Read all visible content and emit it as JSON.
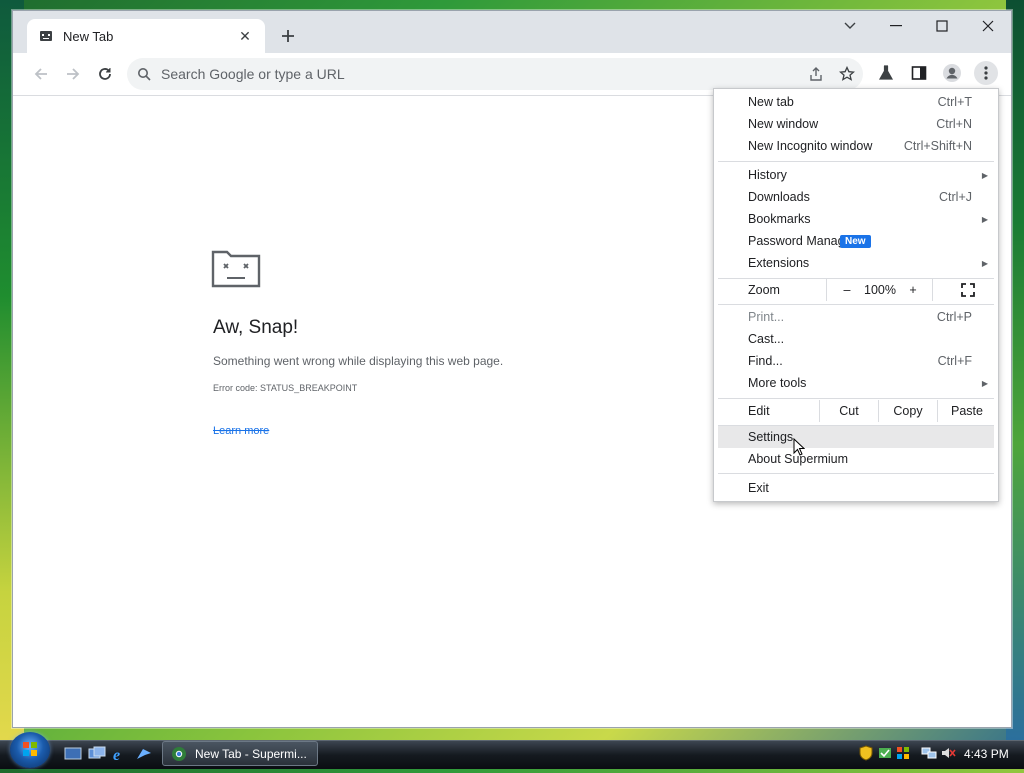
{
  "browser": {
    "tab_title": "New Tab",
    "omnibox_placeholder": "Search Google or type a URL"
  },
  "error_page": {
    "title": "Aw, Snap!",
    "message": "Something went wrong while displaying this web page.",
    "error_code": "Error code: STATUS_BREAKPOINT",
    "learn_more": "Learn more"
  },
  "menu": {
    "new_tab": {
      "label": "New tab",
      "shortcut": "Ctrl+T"
    },
    "new_window": {
      "label": "New window",
      "shortcut": "Ctrl+N"
    },
    "new_incognito": {
      "label": "New Incognito window",
      "shortcut": "Ctrl+Shift+N"
    },
    "history": {
      "label": "History"
    },
    "downloads": {
      "label": "Downloads",
      "shortcut": "Ctrl+J"
    },
    "bookmarks": {
      "label": "Bookmarks"
    },
    "password_manager": {
      "label": "Password Manager",
      "badge": "New"
    },
    "extensions": {
      "label": "Extensions"
    },
    "zoom": {
      "label": "Zoom",
      "minus": "–",
      "value": "100%",
      "plus": "+"
    },
    "print": {
      "label": "Print...",
      "shortcut": "Ctrl+P"
    },
    "cast": {
      "label": "Cast..."
    },
    "find": {
      "label": "Find...",
      "shortcut": "Ctrl+F"
    },
    "more_tools": {
      "label": "More tools"
    },
    "edit": {
      "label": "Edit",
      "cut": "Cut",
      "copy": "Copy",
      "paste": "Paste"
    },
    "settings": {
      "label": "Settings"
    },
    "about": {
      "label": "About Supermium"
    },
    "exit": {
      "label": "Exit"
    }
  },
  "taskbar": {
    "task_label": "New Tab - Supermi...",
    "clock": "4:43 PM"
  },
  "colors": {
    "accent": "#1a73e8",
    "hover_row": "#e8e8e9"
  },
  "icons": [
    "back-icon",
    "forward-icon",
    "reload-icon",
    "search-icon",
    "share-icon",
    "star-icon",
    "labs-icon",
    "side-panel-icon",
    "profile-icon",
    "kebab-menu-icon",
    "sad-tab-icon"
  ]
}
